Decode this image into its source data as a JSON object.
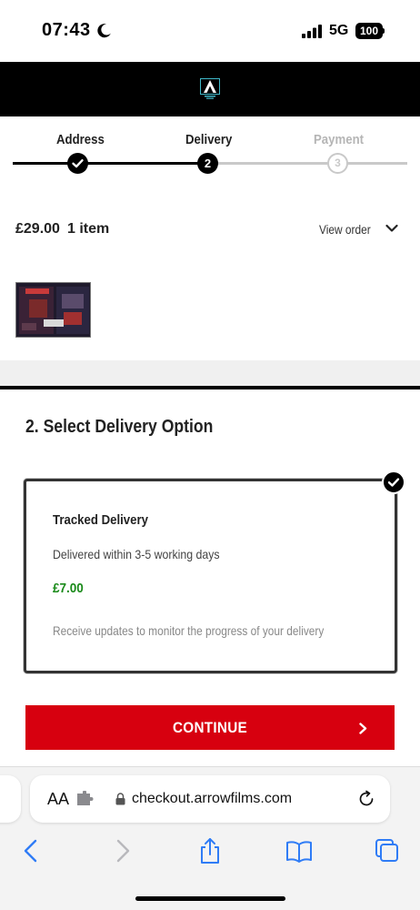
{
  "status_bar": {
    "time": "07:43",
    "network": "5G",
    "battery": "100"
  },
  "checkout": {
    "steps": [
      {
        "label": "Address",
        "state": "done"
      },
      {
        "label": "Delivery",
        "state": "current",
        "number": "2"
      },
      {
        "label": "Payment",
        "state": "upcoming",
        "number": "3"
      }
    ]
  },
  "order": {
    "total": "£29.00",
    "count": "1 item",
    "view_label": "View order"
  },
  "delivery": {
    "section_title": "2. Select Delivery Option",
    "option": {
      "title": "Tracked Delivery",
      "description": "Delivered within 3-5 working days",
      "price": "£7.00",
      "note": "Receive updates to monitor the progress of your delivery",
      "selected": true
    }
  },
  "continue_label": "CONTINUE",
  "browser": {
    "aa_label": "AA",
    "url": "checkout.arrowfilms.com"
  },
  "colors": {
    "accent_red": "#d7000f",
    "price_green": "#1a8a1a",
    "ios_blue": "#2f7cf6"
  }
}
